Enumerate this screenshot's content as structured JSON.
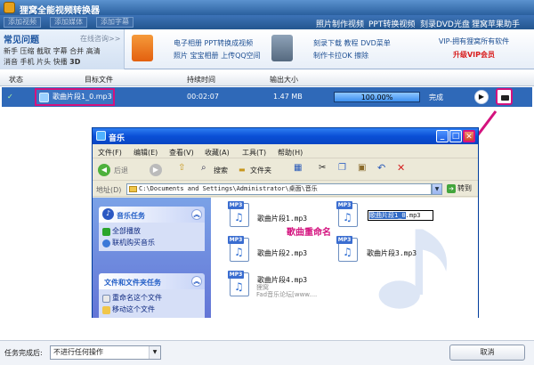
{
  "app": {
    "title": "狸窝全能视频转换器",
    "menu_ghost": [
      "添加视频",
      "添加媒体",
      "添加字幕"
    ],
    "menu": [
      "照片制作视频",
      "PPT转换视频",
      "刻录DVD光盘",
      "狸窝苹果助手"
    ]
  },
  "promo": {
    "faq_title": "常见问题",
    "faq_more": "在线咨询>>",
    "faq_line1": "新手 压缩 截取 字幕 合并 高清",
    "faq_line2a": "消音 手机 片头 快播 ",
    "faq_line2b": "3D",
    "item1_a": "电子相册 PPT转换成视频",
    "item1_b": "照片 宝宝相册 上传QQ空间",
    "item2_a": "刻录下载 教程 DVD菜单",
    "item2_b": "制作卡拉OK 擦除",
    "vip_a": "VIP-拥有狸窝所有软件",
    "vip_b": "升级VIP会员"
  },
  "table": {
    "headers": [
      "状态",
      "目标文件",
      "持续时间",
      "输出大小"
    ],
    "row": {
      "status": "✓",
      "file": "歌曲片段1_0.mp3",
      "duration": "00:02:07",
      "size": "1.47 MB",
      "progress_text": "100.00%",
      "progress": 1.0,
      "state": "完成"
    }
  },
  "explorer": {
    "title": "音乐",
    "menu": [
      "文件(F)",
      "编辑(E)",
      "查看(V)",
      "收藏(A)",
      "工具(T)",
      "帮助(H)"
    ],
    "back": "后退",
    "search": "搜索",
    "folders": "文件夹",
    "address_label": "地址(D)",
    "address": "C:\\Documents and Settings\\Administrator\\桌面\\音乐",
    "goto": "转到",
    "music_tasks": "音乐任务",
    "play_all": "全部播放",
    "buy_music": "联机购买音乐",
    "file_tasks": "文件和文件夹任务",
    "rename_task": "重命名这个文件",
    "move_task": "移动这个文件",
    "files": [
      "歌曲片段1.mp3",
      "歌曲片段2.mp3",
      "歌曲片段3.mp3",
      "歌曲片段4.mp3"
    ],
    "renamed_selected": "歌曲片段1_0",
    "renamed_ext": ".mp3",
    "rename_label": "歌曲重命名",
    "watermark1": "狸窝",
    "watermark2": "Fad音乐论坛[www....",
    "mp3_tag": "MP3"
  },
  "bottom": {
    "label": "任务完成后:",
    "select": "不进行任何操作",
    "cancel": "取消"
  },
  "colors": {
    "row": "#2f69b8",
    "highlight": "#d4127e",
    "xp_title": "#0a4fd6"
  }
}
